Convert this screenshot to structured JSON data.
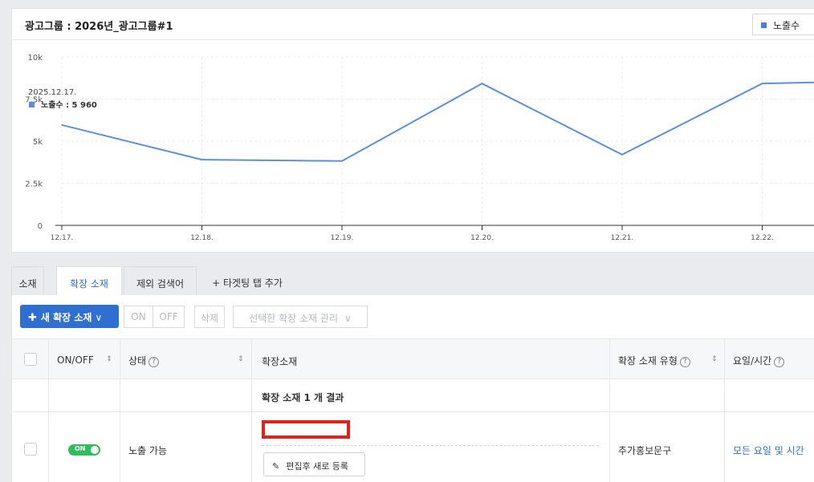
{
  "chart_card": {
    "title": "광고그룹 : 2026년_광고그룹#1",
    "metric_select": "노출수"
  },
  "chart_data": {
    "type": "line",
    "categories": [
      "12.17.",
      "12.18.",
      "12.19.",
      "12.20.",
      "12.21.",
      "12.22."
    ],
    "series": [
      {
        "name": "노출수",
        "values": [
          5960,
          3900,
          3820,
          8420,
          4200,
          8420,
          8600
        ],
        "color": "#5b8fe0"
      }
    ],
    "y_ticks": [
      "0",
      "2.5k",
      "5k",
      "7.5k",
      "10k"
    ],
    "y_tick_values": [
      0,
      2500,
      5000,
      7500,
      10000
    ],
    "ylim": [
      0,
      10000
    ],
    "grid": true,
    "tooltip": {
      "date": "2025.12.17.",
      "label": "노출수 : 5 960"
    }
  },
  "tabs": [
    {
      "label": "소재"
    },
    {
      "label": "확장 소재"
    },
    {
      "label": "제외 검색어"
    },
    {
      "label": "+ 타겟팅 탭 추가"
    }
  ],
  "toolbar": {
    "new_label": "새 확장 소재",
    "on_label": "ON",
    "off_label": "OFF",
    "delete_label": "삭제",
    "manage_label": "선택한 확장 소재 관리"
  },
  "table": {
    "headers": {
      "onoff": "ON/OFF",
      "status": "상태",
      "extension": "확장소재",
      "type": "확장 소재 유형",
      "schedule": "요일/시간"
    },
    "summary": "확장 소재 1 개 결과",
    "row": {
      "toggle": "ON",
      "status": "노출 가능",
      "edit_button": "편집후 새로 등록",
      "type": "추가홍보문구",
      "schedule": "모든 요일 및 시간"
    }
  },
  "icons": {
    "metric_square": "square-icon",
    "help": "question-circle-icon",
    "sort": "sort-arrows-icon",
    "pencil": "pencil-icon",
    "plus": "plus-icon",
    "chevron": "chevron-down-icon"
  }
}
